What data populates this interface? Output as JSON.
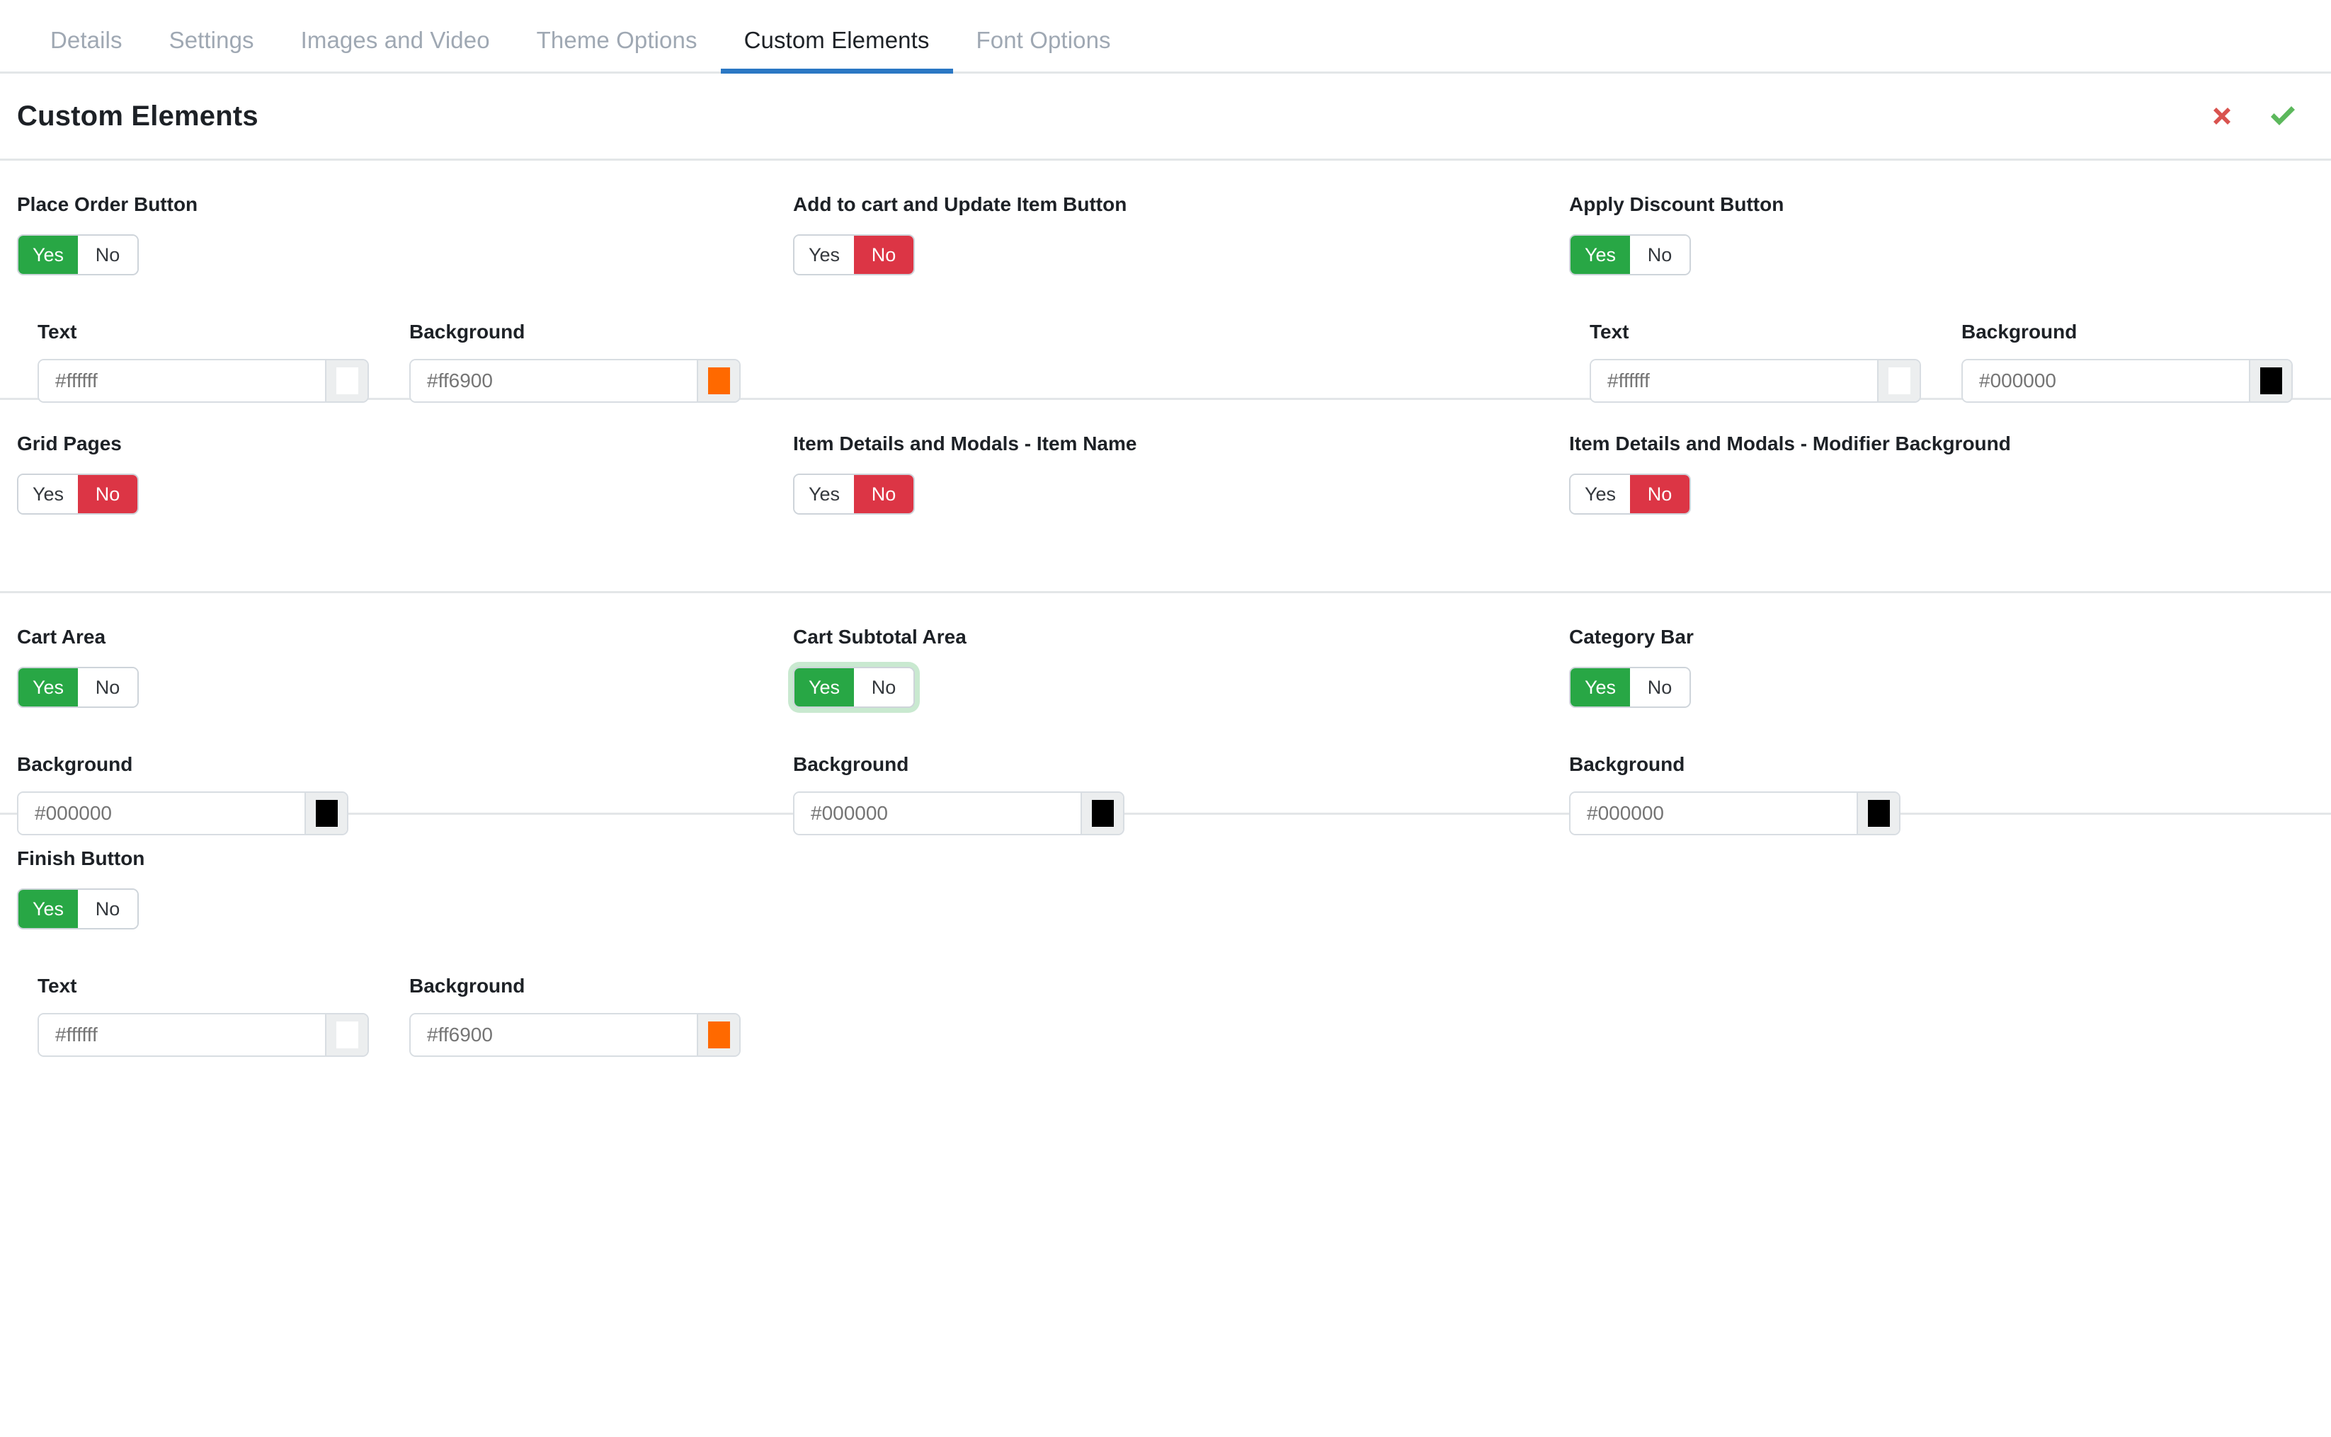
{
  "tabs": [
    {
      "label": "Details",
      "active": false
    },
    {
      "label": "Settings",
      "active": false
    },
    {
      "label": "Images and Video",
      "active": false
    },
    {
      "label": "Theme Options",
      "active": false
    },
    {
      "label": "Custom Elements",
      "active": true
    },
    {
      "label": "Font Options",
      "active": false
    }
  ],
  "header": {
    "title": "Custom Elements",
    "cancel_icon": "red-x-icon",
    "save_icon": "green-check-icon",
    "cancel_color": "#d9534f",
    "save_color": "#5cb85c"
  },
  "toggle_options": {
    "yes": "Yes",
    "no": "No"
  },
  "labels": {
    "text": "Text",
    "background": "Background"
  },
  "sections": [
    {
      "fields": [
        {
          "label": "Place Order Button",
          "value": "Yes",
          "focused": false,
          "sub": [
            {
              "label": "Text",
              "value": "#ffffff",
              "swatch": "#ffffff"
            },
            {
              "label": "Background",
              "value": "#ff6900",
              "swatch": "#ff6900"
            }
          ]
        },
        {
          "label": "Add to cart and Update Item Button",
          "value": "No",
          "focused": false,
          "sub": []
        },
        {
          "label": "Apply Discount Button",
          "value": "Yes",
          "focused": false,
          "sub": [
            {
              "label": "Text",
              "value": "#ffffff",
              "swatch": "#ffffff"
            },
            {
              "label": "Background",
              "value": "#000000",
              "swatch": "#000000"
            }
          ]
        }
      ]
    },
    {
      "fields": [
        {
          "label": "Grid Pages",
          "value": "No",
          "focused": false,
          "sub": []
        },
        {
          "label": "Item Details and Modals - Item Name",
          "value": "No",
          "focused": false,
          "sub": []
        },
        {
          "label": "Item Details and Modals - Modifier Background",
          "value": "No",
          "focused": false,
          "sub": []
        }
      ]
    },
    {
      "fields": [
        {
          "label": "Cart Area",
          "value": "Yes",
          "focused": false,
          "sub": [
            {
              "label": "Background",
              "value": "#000000",
              "swatch": "#000000"
            }
          ]
        },
        {
          "label": "Cart Subtotal Area",
          "value": "Yes",
          "focused": true,
          "sub": [
            {
              "label": "Background",
              "value": "#000000",
              "swatch": "#000000"
            }
          ]
        },
        {
          "label": "Category Bar",
          "value": "Yes",
          "focused": false,
          "sub": [
            {
              "label": "Background",
              "value": "#000000",
              "swatch": "#000000"
            }
          ]
        }
      ]
    },
    {
      "fields": [
        {
          "label": "Finish Button",
          "value": "Yes",
          "focused": false,
          "sub": [
            {
              "label": "Text",
              "value": "#ffffff",
              "swatch": "#ffffff"
            },
            {
              "label": "Background",
              "value": "#ff6900",
              "swatch": "#ff6900"
            }
          ]
        }
      ]
    }
  ]
}
